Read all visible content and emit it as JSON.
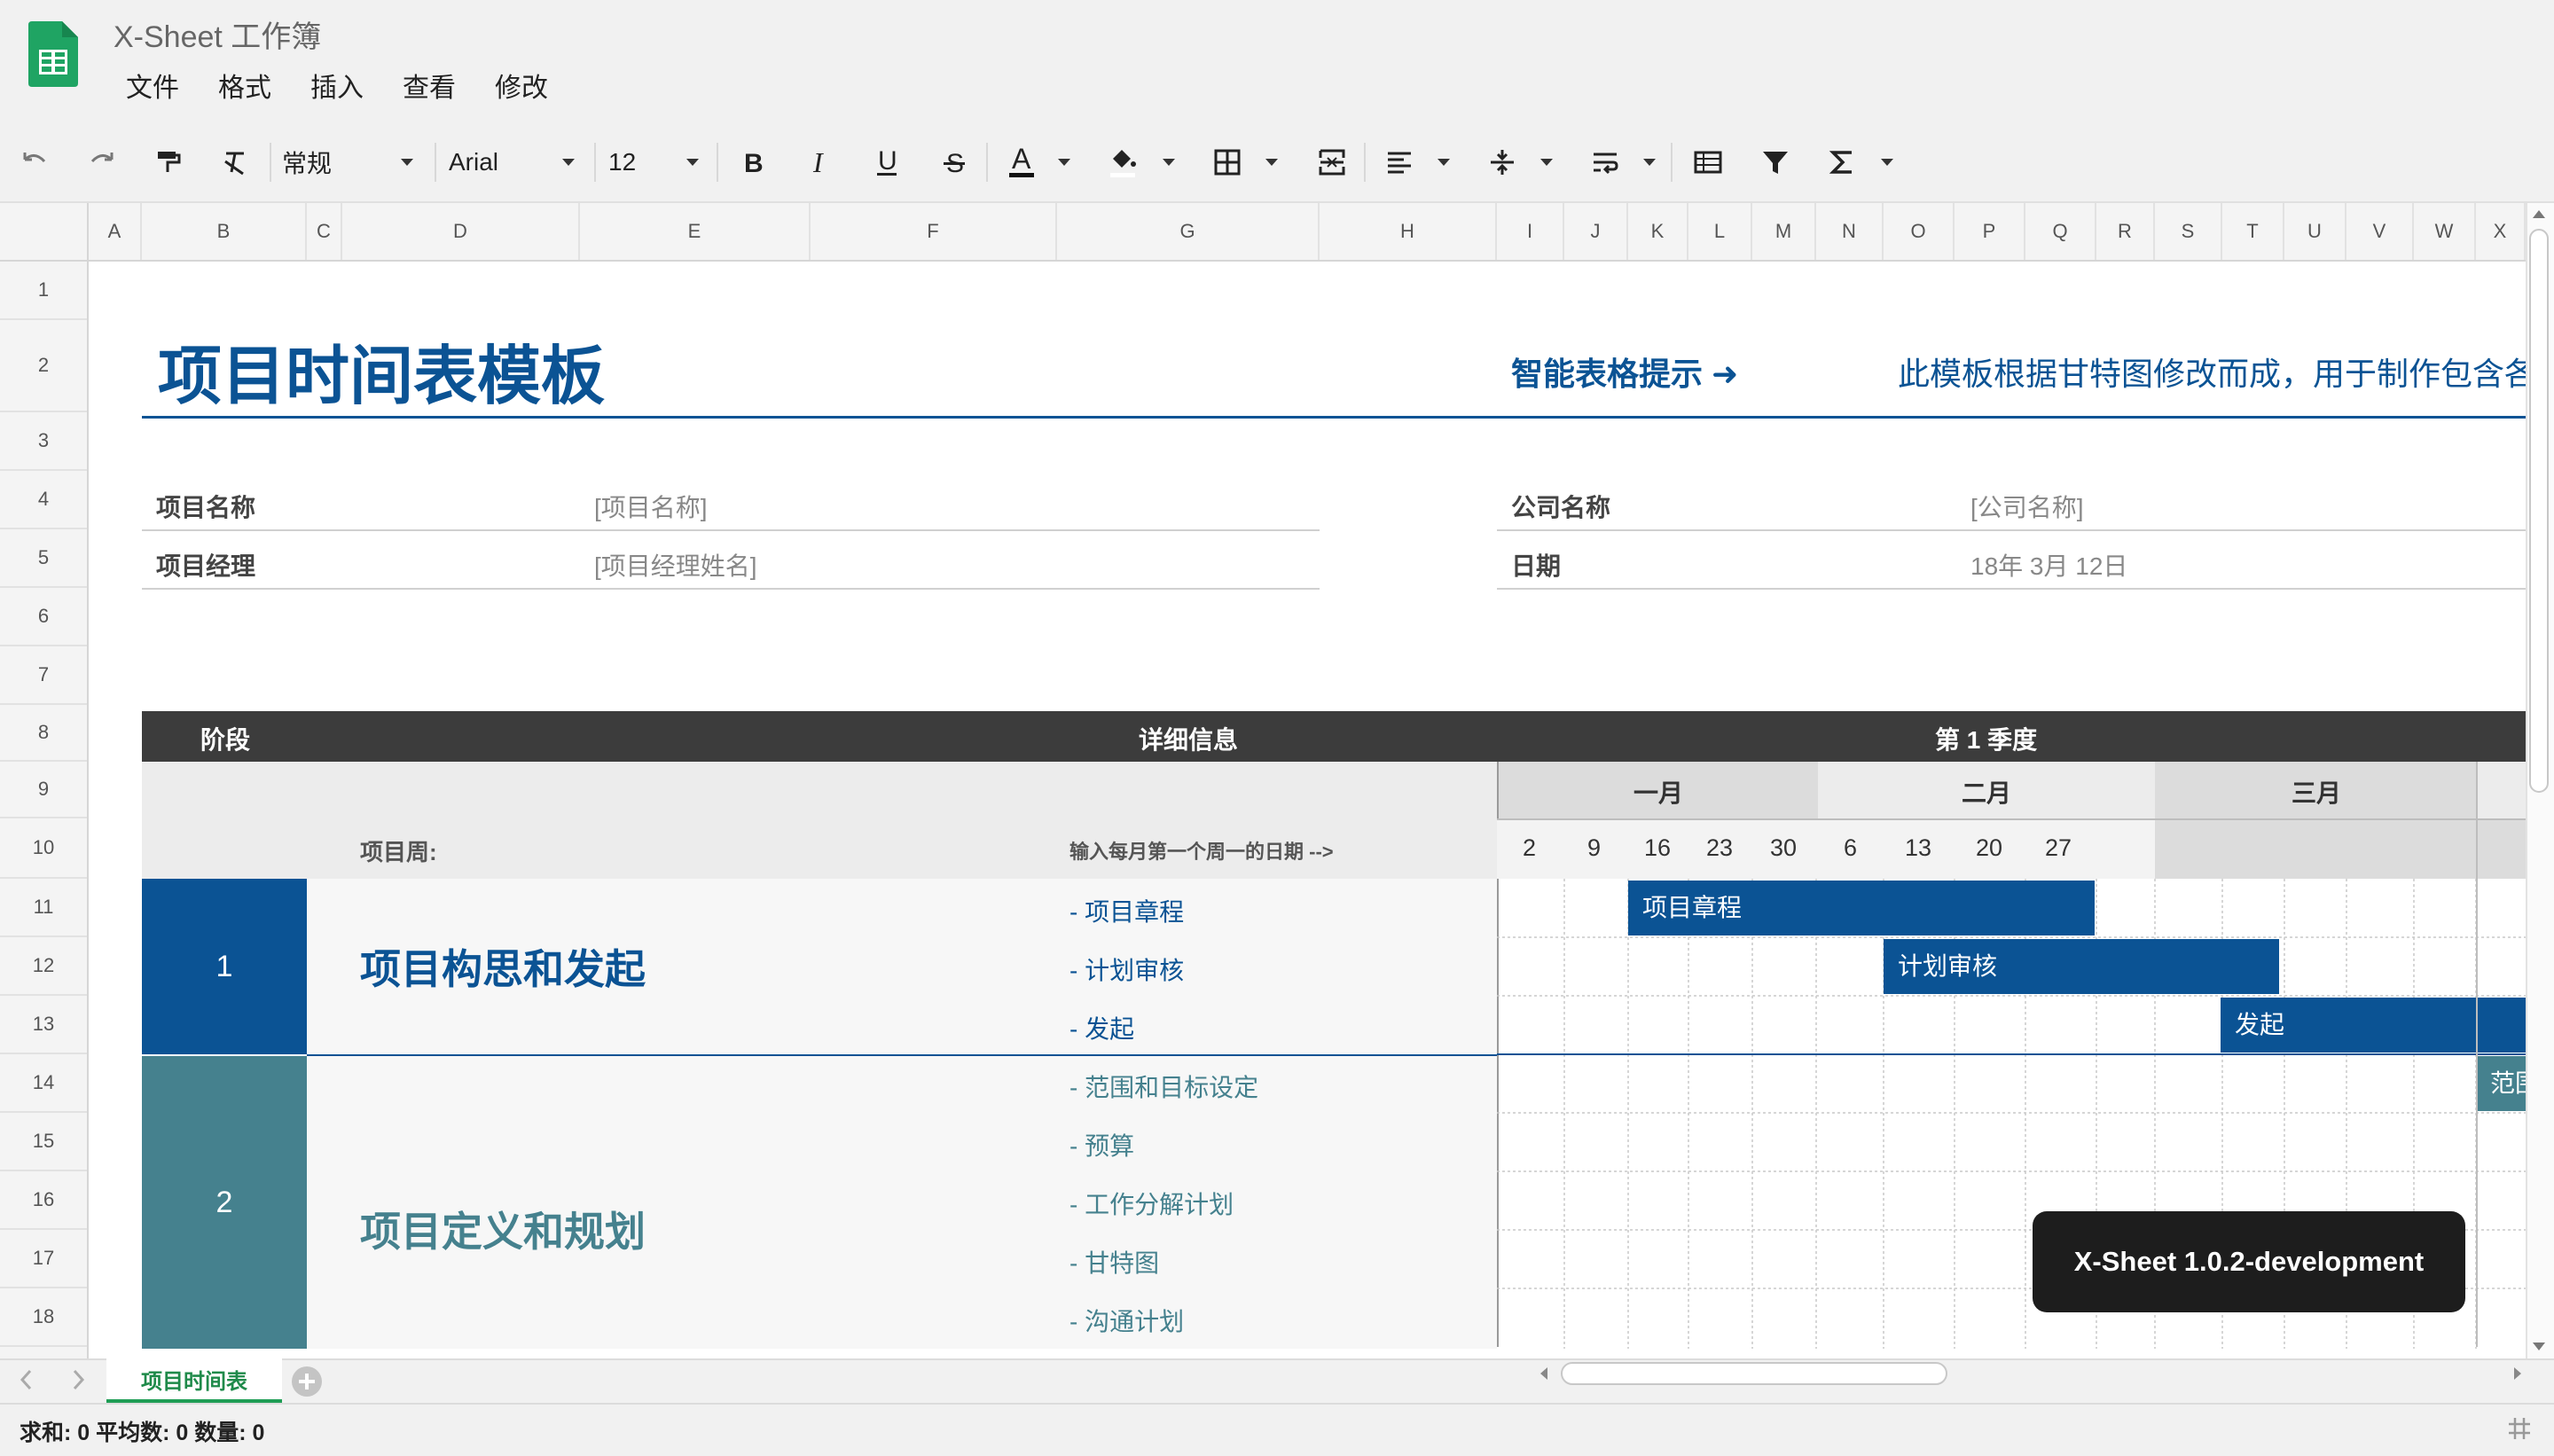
{
  "app": {
    "title": "X-Sheet 工作簿"
  },
  "menu": [
    "文件",
    "格式",
    "插入",
    "查看",
    "修改"
  ],
  "toolbar": {
    "format": "常规",
    "font": "Arial",
    "size": "12"
  },
  "columns": [
    "A",
    "B",
    "C",
    "D",
    "E",
    "F",
    "G",
    "H",
    "I",
    "J",
    "K",
    "L",
    "M",
    "N",
    "O",
    "P",
    "Q",
    "R",
    "S",
    "T",
    "U",
    "V",
    "W",
    "X"
  ],
  "rows": [
    "1",
    "2",
    "3",
    "4",
    "5",
    "6",
    "7",
    "8",
    "9",
    "10",
    "11",
    "12",
    "13",
    "14",
    "15",
    "16",
    "17",
    "18"
  ],
  "sheet": {
    "title": "项目时间表模板",
    "tip_link": "智能表格提示 ➜",
    "tip_desc": "此模板根据甘特图修改而成，用于制作包含各",
    "labels": {
      "project_name": "项目名称",
      "project_name_val": "[项目名称]",
      "manager": "项目经理",
      "manager_val": "[项目经理姓名]",
      "company": "公司名称",
      "company_val": "[公司名称]",
      "date": "日期",
      "date_val": "18年 3月 12日"
    },
    "header": {
      "phase": "阶段",
      "details": "详细信息",
      "quarter": "第 1 季度"
    },
    "months": [
      "一月",
      "二月",
      "三月"
    ],
    "week_label": "项目周:",
    "week_hint": "输入每月第一个周一的日期 -->",
    "week_dates": [
      "2",
      "9",
      "16",
      "23",
      "30",
      "6",
      "13",
      "20",
      "27"
    ],
    "phase1": {
      "num": "1",
      "name": "项目构思和发起",
      "items": [
        "- 项目章程",
        "- 计划审核",
        "- 发起"
      ]
    },
    "phase2": {
      "num": "2",
      "name": "项目定义和规划",
      "items": [
        "- 范围和目标设定",
        "- 预算",
        "- 工作分解计划",
        "- 甘特图",
        "- 沟通计划"
      ]
    },
    "gantt_bars": [
      "项目章程",
      "计划审核",
      "发起",
      "范围"
    ],
    "colors": {
      "phase1": "#0b5394",
      "phase2": "#45818e",
      "header_dark": "#3c3c3c"
    }
  },
  "tabs": {
    "active": "项目时间表"
  },
  "status": "求和: 0  平均数: 0  数量: 0",
  "toast": "X-Sheet 1.0.2-development"
}
